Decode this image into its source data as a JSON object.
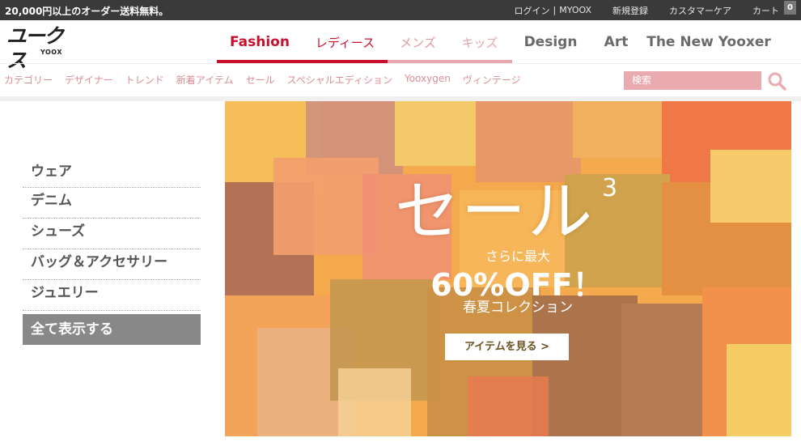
{
  "topbar": {
    "promo": "20,000円以上のオーダー送料無料。",
    "login": "ログイン",
    "separator": "|",
    "myoox": "MYOOX",
    "register": "新規登録",
    "customer_care": "カスタマーケア",
    "cart": "カート",
    "cart_count": "0"
  },
  "logo": {
    "mark": "ユークス",
    "sub": "YOOX"
  },
  "mainnav": {
    "fashion": "Fashion",
    "ladies": "レディース",
    "mens": "メンズ",
    "kids": "キッズ",
    "design": "Design",
    "art": "Art",
    "new_yooxer": "The New Yooxer"
  },
  "subnav": {
    "items": [
      "カテゴリー",
      "デザイナー",
      "トレンド",
      "新着アイテム",
      "セール",
      "スペシャルエディション",
      "Yooxygen",
      "ヴィンテージ"
    ],
    "search_placeholder": "検索"
  },
  "sidebar": {
    "items": [
      "ウェア",
      "デニム",
      "シューズ",
      "バッグ＆アクセサリー",
      "ジュエリー"
    ],
    "show_all": "全て表示する"
  },
  "banner": {
    "title": "セール",
    "superscript": "3",
    "subtitle": "さらに最大",
    "discount": "60%OFF！",
    "collection": "春夏コレクション",
    "button": "アイテムを見る >"
  },
  "colors": {
    "brand_red": "#c8102e",
    "pink": "#e8a7ae",
    "topbar_bg": "#3a3a3a",
    "sidebar_active": "#888888"
  }
}
